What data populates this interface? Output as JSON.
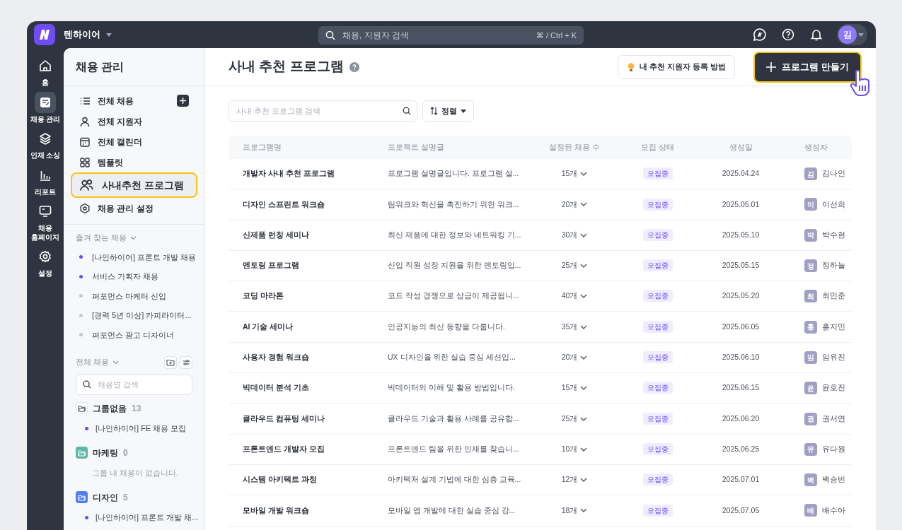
{
  "topbar": {
    "workspace": "텐하이어",
    "search": {
      "placeholder": "채용, 지원자 검색",
      "shortcut": "⌘ / Ctrl + K"
    },
    "user_initial": "김"
  },
  "rail": [
    {
      "label": "홈",
      "selected": false
    },
    {
      "label": "채용 관리",
      "selected": true
    },
    {
      "label": "인재 소싱",
      "selected": false
    },
    {
      "label": "리포트",
      "selected": false
    },
    {
      "label": "채용 홈페이지",
      "selected": false
    },
    {
      "label": "설정",
      "selected": false
    }
  ],
  "sidebar": {
    "title": "채용 관리",
    "items": [
      {
        "label": "전체 채용",
        "kind": "addable",
        "selected": false
      },
      {
        "label": "전체 지원자",
        "kind": "link",
        "selected": false
      },
      {
        "label": "전체 캘린더",
        "kind": "link",
        "selected": false
      },
      {
        "label": "템플릿",
        "kind": "link",
        "selected": false
      },
      {
        "label": "사내추천 프로그램",
        "kind": "link",
        "selected": true
      },
      {
        "label": "채용 관리 설정",
        "kind": "link",
        "selected": false
      }
    ],
    "favorites": {
      "title": "즐겨 찾는 채용",
      "items": [
        {
          "label": "[나인하이어] 프론트 개발 채용",
          "color": "#6b4cf6"
        },
        {
          "label": "서비스 기획자 채용",
          "color": "#6b4cf6"
        },
        {
          "label": "퍼포먼스 마케터 신입",
          "color": "#c5c8d0"
        },
        {
          "label": "[경력 5년 이상] 카피라이터...",
          "color": "#c5c8d0"
        },
        {
          "label": "퍼포먼스 광고 디자이너",
          "color": "#c5c8d0"
        }
      ]
    },
    "all_jobs": {
      "title": "전체 채용",
      "search_placeholder": "채용명 검색",
      "groups": [
        {
          "name": "그룹없음",
          "count": "13",
          "color": "#ffffff",
          "items": [
            {
              "label": "[나인하이어] FE 채용 모집",
              "color": "#6b4cf6"
            }
          ]
        },
        {
          "name": "마케팅",
          "count": "0",
          "color": "#5fb8a4",
          "empty_text": "그룹 내 채용이 없습니다."
        },
        {
          "name": "디자인",
          "count": "5",
          "color": "#4f7ef0",
          "items": [
            {
              "label": "[나인하이어] 프론트 개발 채...",
              "color": "#6b4cf6"
            }
          ]
        }
      ]
    }
  },
  "page": {
    "title": "사내 추천 프로그램",
    "guide_button": "내 추천 지원자 등록 방법",
    "create_button": {
      "label": "프로그램 만들기",
      "highlighted": true
    },
    "search_placeholder": "사내 추천 프로그램 검색",
    "sort_button": "정렬"
  },
  "table": {
    "columns": [
      "프로그램명",
      "프로젝트 설명글",
      "설정된 채용 수",
      "모집 상태",
      "생성일",
      "생성자"
    ],
    "rows": [
      {
        "name": "개발자 사내 추천 프로그램",
        "description": "프로그램 설명글입니다. 프로그램 설...",
        "count": "15개",
        "status": "모집중",
        "date": "2025.04.24",
        "initial": "김",
        "creator": "김나인"
      },
      {
        "name": "디자인 스프린트 워크숍",
        "description": "팀워크와 혁신을 촉진하기 위한 워크...",
        "count": "20개",
        "status": "모집중",
        "date": "2025.05.01",
        "initial": "이",
        "creator": "이선희"
      },
      {
        "name": "신제품 런칭 세미나",
        "description": "최신 제품에 대한 정보와 네트워킹 기...",
        "count": "30개",
        "status": "모집중",
        "date": "2025.05.10",
        "initial": "박",
        "creator": "박수현"
      },
      {
        "name": "멘토링 프로그램",
        "description": "신입 직원 성장 지원을 위한 멘토링입...",
        "count": "25개",
        "status": "모집중",
        "date": "2025.05.15",
        "initial": "정",
        "creator": "정하늘"
      },
      {
        "name": "코딩 마라톤",
        "description": "코드 작성 경쟁으로 상금이 제공됩니...",
        "count": "40개",
        "status": "모집중",
        "date": "2025.05.20",
        "initial": "최",
        "creator": "최민준"
      },
      {
        "name": "AI 기술 세미나",
        "description": "인공지능의 최신 동향을 다룹니다.",
        "count": "35개",
        "status": "모집중",
        "date": "2025.06.05",
        "initial": "홍",
        "creator": "홍지민"
      },
      {
        "name": "사용자 경험 워크숍",
        "description": "UX 디자인을 위한 실습 중심 세션입...",
        "count": "20개",
        "status": "모집중",
        "date": "2025.06.10",
        "initial": "임",
        "creator": "임유진"
      },
      {
        "name": "빅데이터 분석 기초",
        "description": "빅데이터의 이해 및 활용 방법입니다.",
        "count": "15개",
        "status": "모집중",
        "date": "2025.06.15",
        "initial": "윤",
        "creator": "윤호진"
      },
      {
        "name": "클라우드 컴퓨팅 세미나",
        "description": "클라우드 기술과 활용 사례를 공유합...",
        "count": "25개",
        "status": "모집중",
        "date": "2025.06.20",
        "initial": "권",
        "creator": "권서연"
      },
      {
        "name": "프론트엔드 개발자 모집",
        "description": "프론트엔드 팀을 위한 인재를 찾습니...",
        "count": "10개",
        "status": "모집중",
        "date": "2025.06.25",
        "initial": "유",
        "creator": "유다원"
      },
      {
        "name": "시스템 아키텍트 과정",
        "description": "아키텍처 설계 기법에 대한 심층 교육...",
        "count": "12개",
        "status": "모집중",
        "date": "2025.07.01",
        "initial": "백",
        "creator": "백승빈"
      },
      {
        "name": "모바일 개발 워크숍",
        "description": "모바일 앱 개발에 대한 실습 중심 강...",
        "count": "18개",
        "status": "모집중",
        "date": "2025.07.05",
        "initial": "배",
        "creator": "배수아"
      }
    ]
  }
}
